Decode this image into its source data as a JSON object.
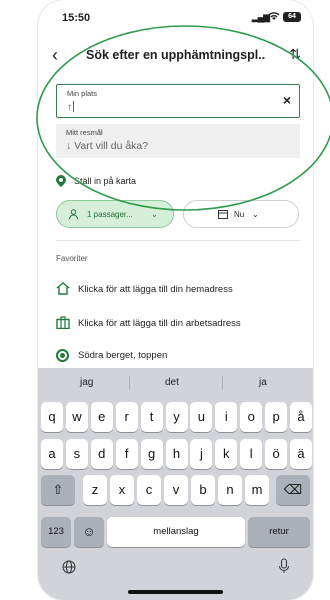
{
  "status_bar": {
    "time": "15:50",
    "signal": "▁▃▅",
    "wifi": "📶",
    "battery": "64"
  },
  "header": {
    "title": "Sök efter en upphämtningspl...",
    "back_icon": "‹",
    "swap_icon": "⇅"
  },
  "from_field": {
    "label": "Min plats",
    "value": "↑",
    "clear_icon": "×"
  },
  "to_field": {
    "label": "Mitt resmål",
    "placeholder": "Vart vill du åka?",
    "arrow": "↓"
  },
  "map_option": {
    "label": "Ställ in på karta"
  },
  "chips": {
    "passengers": {
      "label": "1 passager...",
      "chevron": "⌄"
    },
    "time": {
      "label": "Nu",
      "chevron": "⌄"
    }
  },
  "favorites": {
    "section_label": "Favoriter",
    "items": [
      {
        "label": "Klicka för att lägga till din hemadress",
        "icon": "home-icon"
      },
      {
        "label": "Klicka för att lägga till din arbetsadress",
        "icon": "briefcase-icon"
      },
      {
        "label": "Södra berget, toppen",
        "icon": "location-target-icon"
      }
    ]
  },
  "keyboard": {
    "suggestions": [
      "jag",
      "det",
      "ja"
    ],
    "row1": [
      "q",
      "w",
      "e",
      "r",
      "t",
      "y",
      "u",
      "i",
      "o",
      "p",
      "å"
    ],
    "row2": [
      "a",
      "s",
      "d",
      "f",
      "g",
      "h",
      "j",
      "k",
      "l",
      "ö",
      "ä"
    ],
    "row3": [
      "z",
      "x",
      "c",
      "v",
      "b",
      "n",
      "m"
    ],
    "shift": "⇧",
    "backspace": "⌫",
    "numbers": "123",
    "emoji": "☺",
    "space": "mellanslag",
    "return": "retur",
    "globe": "🌐",
    "mic": "🎙"
  },
  "colors": {
    "accent": "#1e7a3c",
    "annotation": "#2e9b4b"
  }
}
